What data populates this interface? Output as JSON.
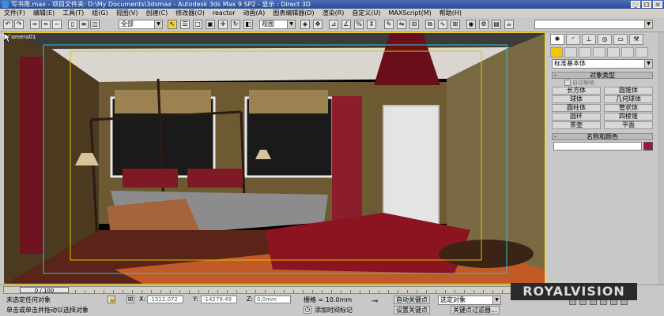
{
  "titlebar": {
    "text": "写书用.max    - 项目文件夹: D:\\My Documents\\3dsmax    - Autodesk 3ds Max 9 SP2    - 显示 : Direct 3D",
    "buttons": [
      "_",
      "□",
      "×"
    ]
  },
  "menubar": {
    "items": [
      "文件(F)",
      "编辑(E)",
      "工具(T)",
      "组(G)",
      "视图(V)",
      "创建(C)",
      "修改器(O)",
      "reactor",
      "动画(A)",
      "图表编辑器(D)",
      "渲染(R)",
      "自定义(U)",
      "MAXScript(M)",
      "帮助(H)"
    ]
  },
  "toolbar": {
    "selection_filter": "全部",
    "ref_coord": "视图"
  },
  "viewport": {
    "label": "Camera01"
  },
  "command_panel": {
    "category": "标准基本体",
    "object_type_title": "对象类型",
    "autogrid": "自动栅格",
    "objects": [
      "长方体",
      "圆锥体",
      "球体",
      "几何球体",
      "圆柱体",
      "管状体",
      "圆环",
      "四棱锥",
      "茶壶",
      "平面"
    ],
    "name_color_title": "名称和颜色",
    "swatch_color": "#a0163a",
    "rollout_sign": "-"
  },
  "status": {
    "time": "0 / 100",
    "selection": "未选定任何对象",
    "prompt": "单击或单击并拖动以选择对象",
    "x_label": "X:",
    "x_value": "-1512.072",
    "y_label": "Y:",
    "y_value": "-14279.49",
    "z_label": "Z:",
    "z_value": "0.0mm",
    "grid": "栅格 = 10.0mm",
    "add_time_tag": "添加时间标记",
    "auto_key": "自动关键点",
    "set_key": "设置关键点",
    "selected_dropdown": "选定对象",
    "key_filters": "关键点过滤器..."
  },
  "watermark": "ROYALVISION"
}
